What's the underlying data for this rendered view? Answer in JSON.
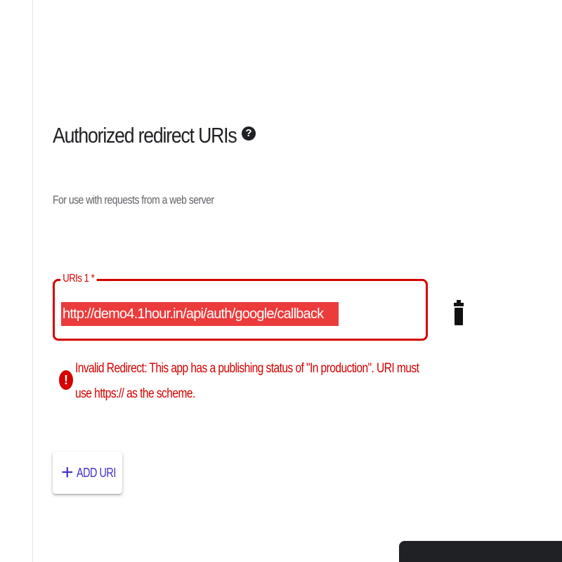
{
  "section": {
    "title": "Authorized redirect URIs",
    "help_icon": "help-circle-icon",
    "subtitle": "For use with requests from a web server"
  },
  "uri_field": {
    "label": "URIs 1 *",
    "value": "http://demo4.1hour.in/api/auth/google/callback",
    "delete_icon": "trash-icon"
  },
  "error": {
    "icon": "error-icon",
    "message": "Invalid Redirect: This app has a publishing status of \"In production\". URI must use https:// as the scheme."
  },
  "add_button": {
    "icon": "plus-icon",
    "label": "ADD URI"
  },
  "colors": {
    "error": "#d50000",
    "selection": "#ec3b3b",
    "accent": "#3f2fc7",
    "text": "#202124",
    "secondary_text": "#5f6368"
  }
}
